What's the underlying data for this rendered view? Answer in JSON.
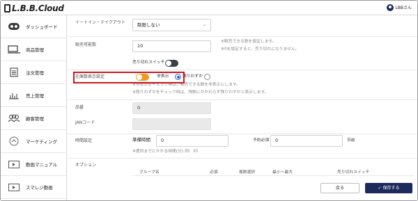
{
  "app": {
    "logo": "L.B.B.Cloud",
    "user": "LBBさん"
  },
  "sidebar": {
    "items": [
      {
        "label": "ダッシュボード",
        "icon": "dashboard-icon"
      },
      {
        "label": "商品管理",
        "icon": "product-icon"
      },
      {
        "label": "注文管理",
        "icon": "order-icon"
      },
      {
        "label": "売上管理",
        "icon": "sales-chart-icon"
      },
      {
        "label": "顧客管理",
        "icon": "customers-icon"
      },
      {
        "label": "マーケティング",
        "icon": "marketing-icon"
      },
      {
        "label": "動画マニュアル",
        "icon": "video-icon"
      },
      {
        "label": "スマレジ動画",
        "icon": "smaregi-video-icon"
      }
    ]
  },
  "form": {
    "eat_in": {
      "label": "イートイン・テイクアウト",
      "value": "制限しない"
    },
    "sellable": {
      "label": "販売可能数",
      "value": "10",
      "hint1": "※販売できる数を設定します。",
      "hint2": "※0を設定すると、売り切れになりません。",
      "soldout_label": "売り切れスイッチ"
    },
    "stock_display": {
      "label": "在庫数表示設定",
      "option_hide": "非表示",
      "option_few": "残りわずか",
      "hint1": "※非表示をチェック時は、販売できる数を非表示にします。",
      "hint2": "※残りわずかをチェック時は、残数にかかわらず残りわずかと表示します。"
    },
    "item_no": {
      "label": "品番",
      "value": "0"
    },
    "jan": {
      "label": "JANコード",
      "value": ""
    },
    "time": {
      "label": "時間設定",
      "prep_label": "準備時間",
      "prep_value": "0",
      "reserve_label": "予約必須",
      "reserve_value": "0",
      "unit": "日前",
      "hint": "※提供までにかかる時間(分) 例）30"
    },
    "options": {
      "label": "オプション",
      "columns": [
        "グループ名",
        "必須",
        "複数選択",
        "最小〜最大",
        "売り切れスイッチ"
      ]
    }
  },
  "footer": {
    "back": "戻る",
    "save": "✓ 保存する"
  },
  "colors": {
    "navy": "#1d2a5c",
    "orange": "#f39a1e",
    "highlight": "#d0121b"
  }
}
